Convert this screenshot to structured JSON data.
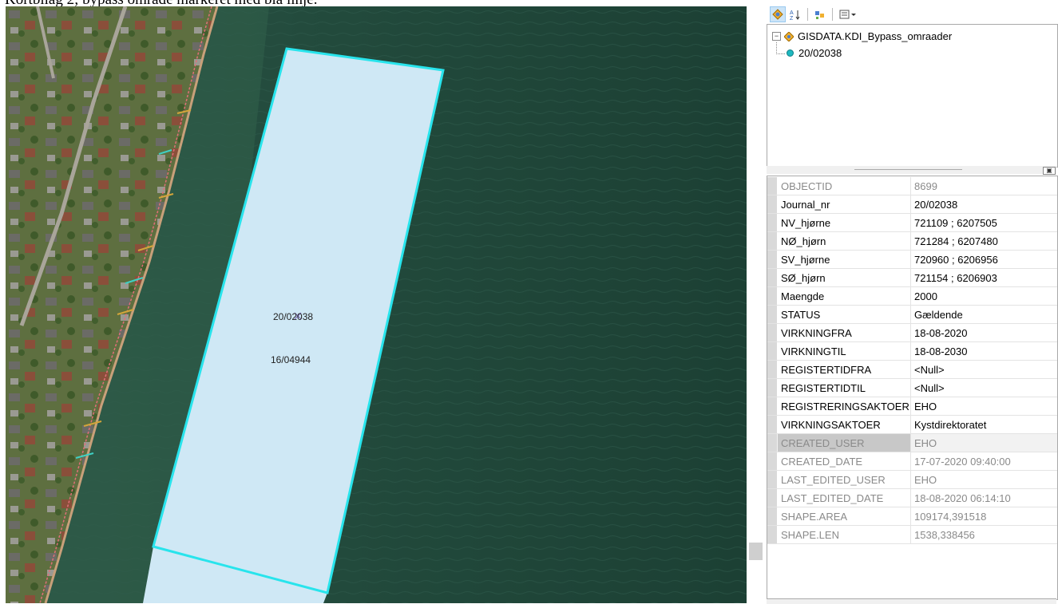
{
  "caption": "Kortbilag 2; bypass område markeret med blå linje.",
  "map": {
    "labels": [
      "20/02038",
      "16/04944"
    ],
    "colors": {
      "polygon_fill": "#cfe8f5",
      "polygon_stroke": "#28e4ec",
      "water": "#1f4538",
      "land": "#5b6b3e"
    }
  },
  "toolbar": {
    "icons": [
      "list-by-layer-icon",
      "sort-az-icon",
      "list-by-selection-icon",
      "options-dropdown-icon"
    ]
  },
  "tree": {
    "layer": "GISDATA.KDI_Bypass_omraader",
    "feature": "20/02038"
  },
  "attributes": [
    {
      "key": "OBJECTID",
      "value": "8699",
      "style": "sys"
    },
    {
      "key": "Journal_nr",
      "value": "20/02038",
      "style": "usr"
    },
    {
      "key": "NV_hjørne",
      "value": "721109 ; 6207505",
      "style": "usr"
    },
    {
      "key": "NØ_hjørn",
      "value": "721284 ; 6207480",
      "style": "usr"
    },
    {
      "key": "SV_hjørne",
      "value": "720960 ; 6206956",
      "style": "usr"
    },
    {
      "key": "SØ_hjørn",
      "value": "721154 ; 6206903",
      "style": "usr"
    },
    {
      "key": "Maengde",
      "value": "2000",
      "style": "usr"
    },
    {
      "key": "STATUS",
      "value": "Gældende",
      "style": "usr"
    },
    {
      "key": "VIRKNINGFRA",
      "value": "18-08-2020",
      "style": "usr"
    },
    {
      "key": "VIRKNINGTIL",
      "value": "18-08-2030",
      "style": "usr"
    },
    {
      "key": "REGISTERTIDFRA",
      "value": "<Null>",
      "style": "usr"
    },
    {
      "key": "REGISTERTIDTIL",
      "value": "<Null>",
      "style": "usr"
    },
    {
      "key": "REGISTRERINGSAKTOER",
      "value": "EHO",
      "style": "usr"
    },
    {
      "key": "VIRKNINGSAKTOER",
      "value": "Kystdirektoratet",
      "style": "usr"
    },
    {
      "key": "CREATED_USER",
      "value": "EHO",
      "style": "sys sel"
    },
    {
      "key": "CREATED_DATE",
      "value": "17-07-2020 09:40:00",
      "style": "sys"
    },
    {
      "key": "LAST_EDITED_USER",
      "value": "EHO",
      "style": "sys"
    },
    {
      "key": "LAST_EDITED_DATE",
      "value": "18-08-2020 06:14:10",
      "style": "sys"
    },
    {
      "key": "SHAPE.AREA",
      "value": "109174,391518",
      "style": "sys"
    },
    {
      "key": "SHAPE.LEN",
      "value": "1538,338456",
      "style": "sys"
    }
  ]
}
